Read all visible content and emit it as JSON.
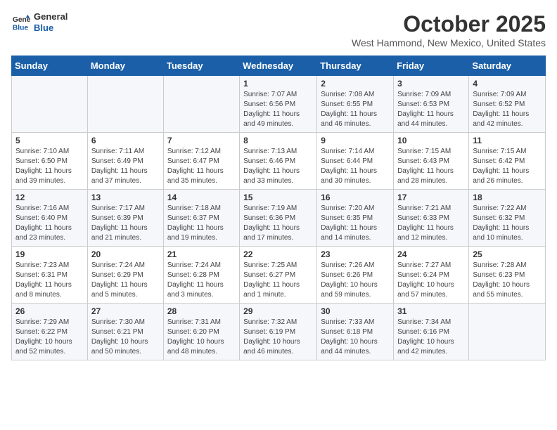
{
  "logo": {
    "line1": "General",
    "line2": "Blue"
  },
  "title": "October 2025",
  "subtitle": "West Hammond, New Mexico, United States",
  "headers": [
    "Sunday",
    "Monday",
    "Tuesday",
    "Wednesday",
    "Thursday",
    "Friday",
    "Saturday"
  ],
  "rows": [
    [
      {
        "day": "",
        "info": ""
      },
      {
        "day": "",
        "info": ""
      },
      {
        "day": "",
        "info": ""
      },
      {
        "day": "1",
        "info": "Sunrise: 7:07 AM\nSunset: 6:56 PM\nDaylight: 11 hours and 49 minutes."
      },
      {
        "day": "2",
        "info": "Sunrise: 7:08 AM\nSunset: 6:55 PM\nDaylight: 11 hours and 46 minutes."
      },
      {
        "day": "3",
        "info": "Sunrise: 7:09 AM\nSunset: 6:53 PM\nDaylight: 11 hours and 44 minutes."
      },
      {
        "day": "4",
        "info": "Sunrise: 7:09 AM\nSunset: 6:52 PM\nDaylight: 11 hours and 42 minutes."
      }
    ],
    [
      {
        "day": "5",
        "info": "Sunrise: 7:10 AM\nSunset: 6:50 PM\nDaylight: 11 hours and 39 minutes."
      },
      {
        "day": "6",
        "info": "Sunrise: 7:11 AM\nSunset: 6:49 PM\nDaylight: 11 hours and 37 minutes."
      },
      {
        "day": "7",
        "info": "Sunrise: 7:12 AM\nSunset: 6:47 PM\nDaylight: 11 hours and 35 minutes."
      },
      {
        "day": "8",
        "info": "Sunrise: 7:13 AM\nSunset: 6:46 PM\nDaylight: 11 hours and 33 minutes."
      },
      {
        "day": "9",
        "info": "Sunrise: 7:14 AM\nSunset: 6:44 PM\nDaylight: 11 hours and 30 minutes."
      },
      {
        "day": "10",
        "info": "Sunrise: 7:15 AM\nSunset: 6:43 PM\nDaylight: 11 hours and 28 minutes."
      },
      {
        "day": "11",
        "info": "Sunrise: 7:15 AM\nSunset: 6:42 PM\nDaylight: 11 hours and 26 minutes."
      }
    ],
    [
      {
        "day": "12",
        "info": "Sunrise: 7:16 AM\nSunset: 6:40 PM\nDaylight: 11 hours and 23 minutes."
      },
      {
        "day": "13",
        "info": "Sunrise: 7:17 AM\nSunset: 6:39 PM\nDaylight: 11 hours and 21 minutes."
      },
      {
        "day": "14",
        "info": "Sunrise: 7:18 AM\nSunset: 6:37 PM\nDaylight: 11 hours and 19 minutes."
      },
      {
        "day": "15",
        "info": "Sunrise: 7:19 AM\nSunset: 6:36 PM\nDaylight: 11 hours and 17 minutes."
      },
      {
        "day": "16",
        "info": "Sunrise: 7:20 AM\nSunset: 6:35 PM\nDaylight: 11 hours and 14 minutes."
      },
      {
        "day": "17",
        "info": "Sunrise: 7:21 AM\nSunset: 6:33 PM\nDaylight: 11 hours and 12 minutes."
      },
      {
        "day": "18",
        "info": "Sunrise: 7:22 AM\nSunset: 6:32 PM\nDaylight: 11 hours and 10 minutes."
      }
    ],
    [
      {
        "day": "19",
        "info": "Sunrise: 7:23 AM\nSunset: 6:31 PM\nDaylight: 11 hours and 8 minutes."
      },
      {
        "day": "20",
        "info": "Sunrise: 7:24 AM\nSunset: 6:29 PM\nDaylight: 11 hours and 5 minutes."
      },
      {
        "day": "21",
        "info": "Sunrise: 7:24 AM\nSunset: 6:28 PM\nDaylight: 11 hours and 3 minutes."
      },
      {
        "day": "22",
        "info": "Sunrise: 7:25 AM\nSunset: 6:27 PM\nDaylight: 11 hours and 1 minute."
      },
      {
        "day": "23",
        "info": "Sunrise: 7:26 AM\nSunset: 6:26 PM\nDaylight: 10 hours and 59 minutes."
      },
      {
        "day": "24",
        "info": "Sunrise: 7:27 AM\nSunset: 6:24 PM\nDaylight: 10 hours and 57 minutes."
      },
      {
        "day": "25",
        "info": "Sunrise: 7:28 AM\nSunset: 6:23 PM\nDaylight: 10 hours and 55 minutes."
      }
    ],
    [
      {
        "day": "26",
        "info": "Sunrise: 7:29 AM\nSunset: 6:22 PM\nDaylight: 10 hours and 52 minutes."
      },
      {
        "day": "27",
        "info": "Sunrise: 7:30 AM\nSunset: 6:21 PM\nDaylight: 10 hours and 50 minutes."
      },
      {
        "day": "28",
        "info": "Sunrise: 7:31 AM\nSunset: 6:20 PM\nDaylight: 10 hours and 48 minutes."
      },
      {
        "day": "29",
        "info": "Sunrise: 7:32 AM\nSunset: 6:19 PM\nDaylight: 10 hours and 46 minutes."
      },
      {
        "day": "30",
        "info": "Sunrise: 7:33 AM\nSunset: 6:18 PM\nDaylight: 10 hours and 44 minutes."
      },
      {
        "day": "31",
        "info": "Sunrise: 7:34 AM\nSunset: 6:16 PM\nDaylight: 10 hours and 42 minutes."
      },
      {
        "day": "",
        "info": ""
      }
    ]
  ]
}
